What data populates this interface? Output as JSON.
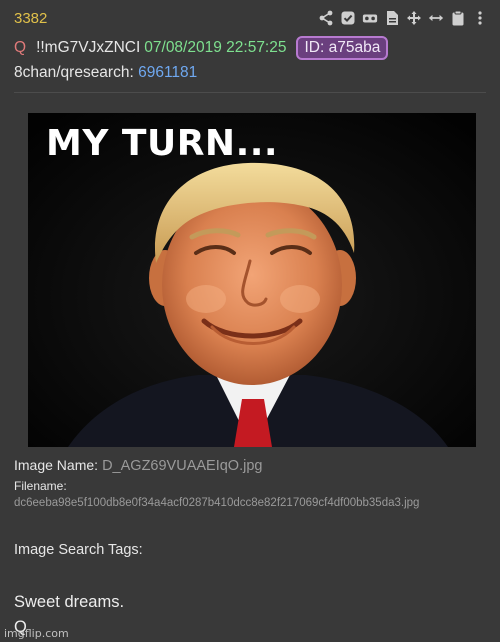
{
  "post": {
    "number": "3382",
    "author_name": "Q",
    "tripcode": "!!mG7VJxZNCI",
    "date": "07/08/2019 22:57:25",
    "id_badge": "ID: a75aba",
    "board_prefix": "8chan/qresearch:",
    "board_post_number": "6961181"
  },
  "toolbar": {
    "icons": [
      "share-icon",
      "check-badge-icon",
      "vr-headset-icon",
      "document-icon",
      "move-icon",
      "expand-horizontal-icon",
      "clipboard-icon",
      "more-icon"
    ]
  },
  "image": {
    "caption": "MY TURN...",
    "image_name_label": "Image Name:",
    "image_name_value": "D_AGZ69VUAAEIqO.jpg",
    "filename_label": "Filename:",
    "filename_value": "dc6eeba98e5f100db8e0f34a4acf0287b410dcc8e82f217069cf4df00bb35da3.jpg",
    "search_tags_label": "Image Search Tags:"
  },
  "message": {
    "line1": "Sweet dreams.",
    "line2": "Q"
  },
  "watermark": "imgflip.com",
  "colors": {
    "background": "#393939",
    "post_number": "#e0c04a",
    "author": "#e07a7a",
    "date": "#7ee08f",
    "id_badge_bg": "#6a3f7e",
    "id_badge_border": "#b77ad0",
    "board_link": "#6fa8f0"
  }
}
